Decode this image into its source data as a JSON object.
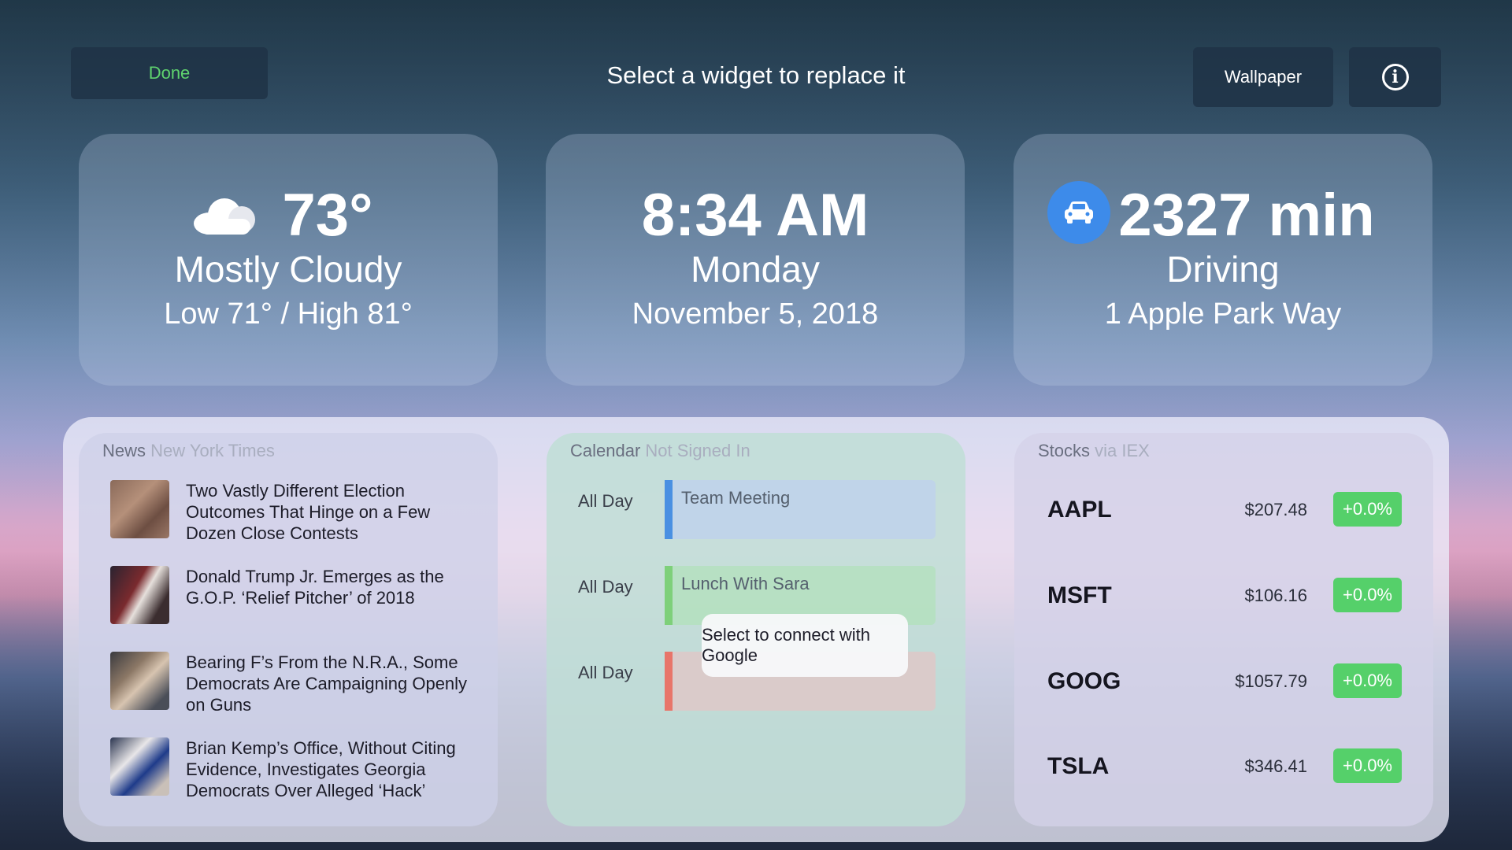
{
  "header": {
    "done_label": "Done",
    "title": "Select a widget to replace it",
    "wallpaper_label": "Wallpaper",
    "info_icon": "info-icon"
  },
  "weather": {
    "temp": "73°",
    "condition": "Mostly Cloudy",
    "range": "Low 71° / High 81°",
    "icon": "cloud-icon"
  },
  "clock": {
    "time": "8:34 AM",
    "day": "Monday",
    "date": "November 5, 2018"
  },
  "commute": {
    "duration": "2327 min",
    "mode": "Driving",
    "destination": "1 Apple Park Way",
    "icon": "car-icon"
  },
  "news": {
    "title": "News",
    "source": "New York Times",
    "items": [
      {
        "headline": "Two Vastly Different Election Outcomes That Hinge on a Few Dozen Close Contests"
      },
      {
        "headline": "Donald Trump Jr. Emerges as the G.O.P. ‘Relief Pitcher’ of 2018"
      },
      {
        "headline": "Bearing F’s From the N.R.A., Some Democrats Are Campaigning Openly on Guns"
      },
      {
        "headline": "Brian Kemp’s Office, Without Citing Evidence, Investigates Georgia Democrats Over Alleged ‘Hack’"
      }
    ]
  },
  "calendar": {
    "title": "Calendar",
    "status": "Not Signed In",
    "events": [
      {
        "time": "All Day",
        "title": "Team Meeting",
        "color": "#4a90e2"
      },
      {
        "time": "All Day",
        "title": "Lunch With Sara",
        "color": "#7ed07a"
      },
      {
        "time": "All Day",
        "title": "",
        "color": "#e8756a"
      }
    ],
    "tooltip": "Select to connect with Google"
  },
  "stocks": {
    "title": "Stocks",
    "source": "via IEX",
    "rows": [
      {
        "ticker": "AAPL",
        "price": "$207.48",
        "change": "+0.0%"
      },
      {
        "ticker": "MSFT",
        "price": "$106.16",
        "change": "+0.0%"
      },
      {
        "ticker": "GOOG",
        "price": "$1057.79",
        "change": "+0.0%"
      },
      {
        "ticker": "TSLA",
        "price": "$346.41",
        "change": "+0.0%"
      }
    ]
  },
  "colors": {
    "accent_green": "#5fd36e",
    "change_green": "#55d06a",
    "car_blue": "#3d8bea"
  }
}
